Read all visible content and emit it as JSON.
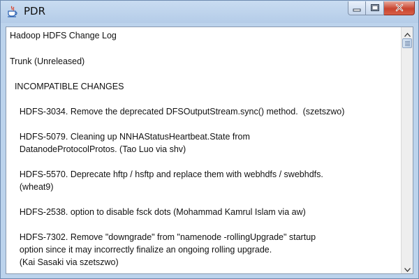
{
  "window": {
    "title": "PDR",
    "icon": "java-cup-icon",
    "controls": [
      "minimize-icon",
      "maximize-icon",
      "close-icon"
    ],
    "accent": "#bcd3ec",
    "close_color": "#c8442f"
  },
  "document": {
    "lines": [
      "Hadoop HDFS Change Log",
      "Trunk (Unreleased)",
      "  INCOMPATIBLE CHANGES",
      "    HDFS-3034. Remove the deprecated DFSOutputStream.sync() method.  (szetszwo)",
      "    HDFS-5079. Cleaning up NNHAStatusHeartbeat.State from",
      "    DatanodeProtocolProtos. (Tao Luo via shv)",
      "    HDFS-5570. Deprecate hftp / hsftp and replace them with webhdfs / swebhdfs.",
      "    (wheat9)",
      "    HDFS-2538. option to disable fsck dots (Mohammad Kamrul Islam via aw)",
      "    HDFS-7302. Remove \"downgrade\" from \"namenode -rollingUpgrade\" startup",
      "    option since it may incorrectly finalize an ongoing rolling upgrade.",
      "    (Kai Sasaki via szetszwo)"
    ]
  }
}
